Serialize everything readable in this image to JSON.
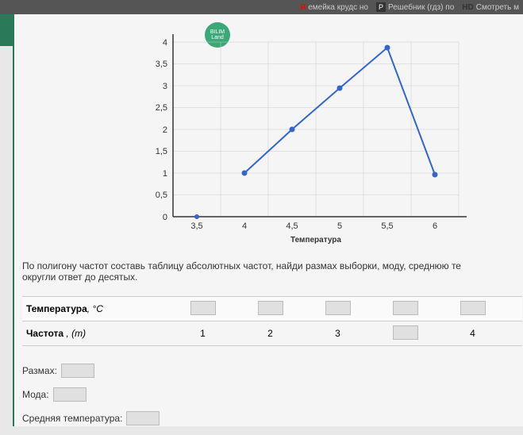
{
  "tabs": {
    "tab1": "емейка крудс но",
    "tab2": "Решебник (гдз) по",
    "tab3": "Смотреть м"
  },
  "badge": "BILIM Land",
  "chart_data": {
    "type": "line",
    "title": "Температура",
    "xlabel": "Температура",
    "ylabel": "",
    "x_ticks": [
      "3,5",
      "4",
      "4,5",
      "5",
      "5,5",
      "6"
    ],
    "y_ticks": [
      "0",
      "0,5",
      "1",
      "1,5",
      "2",
      "2,5",
      "3",
      "3,5",
      "4"
    ],
    "x_values": [
      3.5,
      4,
      4.5,
      5,
      5.5,
      6
    ],
    "y_values": [
      0,
      1,
      2,
      3,
      3,
      4,
      1
    ],
    "series": [
      {
        "x": 3.5,
        "y": 0,
        "isolated": true
      },
      {
        "x": 4,
        "y": 1
      },
      {
        "x": 4.5,
        "y": 2
      },
      {
        "x": 5,
        "y": 3
      },
      {
        "x": 5.5,
        "y": 4
      },
      {
        "x": 6,
        "y": 1
      }
    ],
    "ylim": [
      0,
      4
    ],
    "xlim": [
      3.5,
      6
    ]
  },
  "question": {
    "line1": "По полигону частот составь таблицу абсолютных частот, найди размах выборки, моду, среднюю те",
    "line2": "округли ответ до десятых."
  },
  "table": {
    "row1_label": "Температура",
    "row1_unit": "°C",
    "row2_label": "Частота",
    "row2_unit": "(m)",
    "freq_values": [
      "1",
      "2",
      "3",
      "",
      "4"
    ]
  },
  "answers": {
    "range_label": "Размах:",
    "mode_label": "Мода:",
    "mean_label": "Средняя температура:"
  }
}
